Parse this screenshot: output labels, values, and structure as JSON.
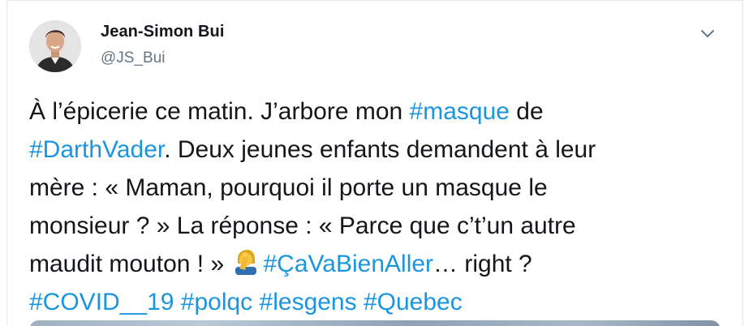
{
  "author": {
    "name": "Jean-Simon Bui",
    "handle": "@JS_Bui"
  },
  "menu_icon": "chevron-down-icon",
  "tweet": {
    "line1": {
      "t1": "À l’épicerie ce matin. J’arbore mon ",
      "tag1": "#masque",
      "t2": " de"
    },
    "line2": {
      "tag1": "#DarthVader",
      "t1": ". Deux jeunes enfants demandent à leur"
    },
    "line3": {
      "t1": "mère : « Maman, pourquoi il porte un masque le"
    },
    "line4": {
      "t1": "monsieur ? » La réponse : « Parce que c’t’un autre"
    },
    "line5": {
      "t1": "maudit mouton ! » ",
      "emoji": "person-facepalming-emoji",
      "tag1": "#ÇaVaBienAller",
      "t2": "… right ?"
    },
    "line6": {
      "tag1": "#COVID__19",
      "tag2": "#polqc",
      "tag3": "#lesgens",
      "tag4": "#Quebec"
    }
  },
  "colors": {
    "hashtag": "#1b95e0",
    "text": "#14171a",
    "secondary": "#657786"
  }
}
